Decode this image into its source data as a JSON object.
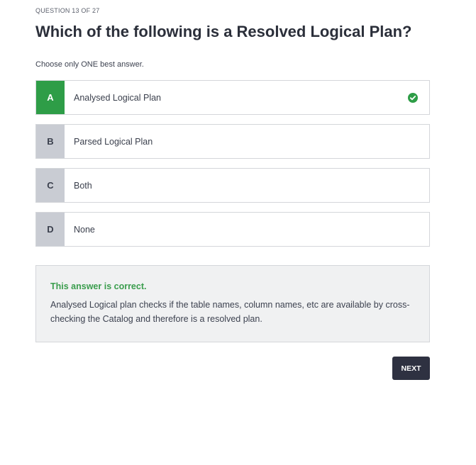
{
  "quiz": {
    "progress": "QUESTION 13 OF 27",
    "question": "Which of the following is a Resolved Logical Plan?",
    "instruction": "Choose only ONE best answer.",
    "options": [
      {
        "letter": "A",
        "text": "Analysed Logical Plan",
        "selected": true,
        "correct": true
      },
      {
        "letter": "B",
        "text": "Parsed Logical Plan"
      },
      {
        "letter": "C",
        "text": "Both"
      },
      {
        "letter": "D",
        "text": "None"
      }
    ],
    "feedback": {
      "title": "This answer is correct.",
      "text": "Analysed Logical plan checks if the table names, column names, etc are available by cross-checking the Catalog and therefore is a resolved plan."
    },
    "next_label": "NEXT"
  },
  "colors": {
    "accent_green": "#2e9d47",
    "button_dark": "#2e3141"
  },
  "icons": {
    "correct": "check-circle-icon"
  }
}
